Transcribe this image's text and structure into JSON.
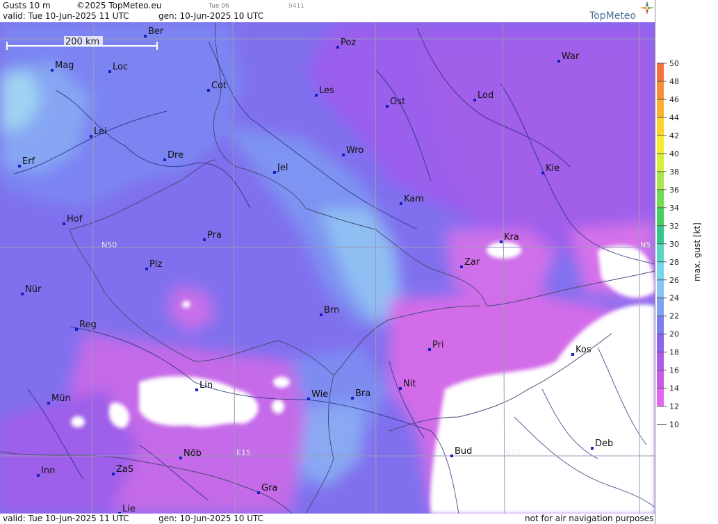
{
  "header": {
    "title": "Gusts 10 m",
    "copyright": "©2025 TopMeteo.eu",
    "run_hint": "Tue 06",
    "code": "9411",
    "valid": "valid:  Tue  10-Jun-2025  11 UTC",
    "generated": "gen: 10-Jun-2025 10 UTC",
    "logo": "TopMeteo"
  },
  "footer": {
    "valid": "valid:  Tue  10-Jun-2025  11 UTC",
    "generated": "gen: 10-Jun-2025 10 UTC",
    "disclaimer": "not for air navigation purposes"
  },
  "scale_bar": "200 km",
  "grid_labels": {
    "n50": "N50",
    "n50_right": "N5",
    "e15": "E15",
    "e20": "E20"
  },
  "cities": [
    "Ber",
    "Poz",
    "War",
    "Mag",
    "Loc",
    "Cot",
    "Les",
    "Ost",
    "Lod",
    "Lei",
    "Erf",
    "Dre",
    "Wro",
    "Jel",
    "Kie",
    "Kam",
    "Hof",
    "Pra",
    "Kra",
    "Plz",
    "Zar",
    "Nür",
    "Brn",
    "Reg",
    "Pri",
    "Kos",
    "Lin",
    "Nit",
    "Wie",
    "Bra",
    "Mün",
    "Deb",
    "Nöb",
    "Bud",
    "Inn",
    "ZaS",
    "Gra",
    "Lie"
  ],
  "legend": {
    "title": "max. gust [kt]",
    "ticks": [
      "50",
      "48",
      "46",
      "44",
      "42",
      "40",
      "38",
      "36",
      "34",
      "32",
      "30",
      "28",
      "26",
      "24",
      "22",
      "20",
      "18",
      "16",
      "14",
      "12",
      "10"
    ],
    "colors": {
      "50": "#f25a40",
      "48": "#f4713a",
      "46": "#f79035",
      "44": "#fab22e",
      "42": "#fcd22a",
      "40": "#f6ec2a",
      "38": "#d8ef38",
      "36": "#a8e84a",
      "34": "#6fdc52",
      "32": "#45cf5b",
      "30": "#30c98a",
      "28": "#58d6c4",
      "26": "#79d6ea",
      "24": "#86c4f5",
      "22": "#7fa3f2",
      "20": "#7b7df0",
      "18": "#8b63ee",
      "16": "#a95ce9",
      "14": "#c95be8",
      "12": "#e566f0",
      "10": "#ffffff"
    }
  }
}
